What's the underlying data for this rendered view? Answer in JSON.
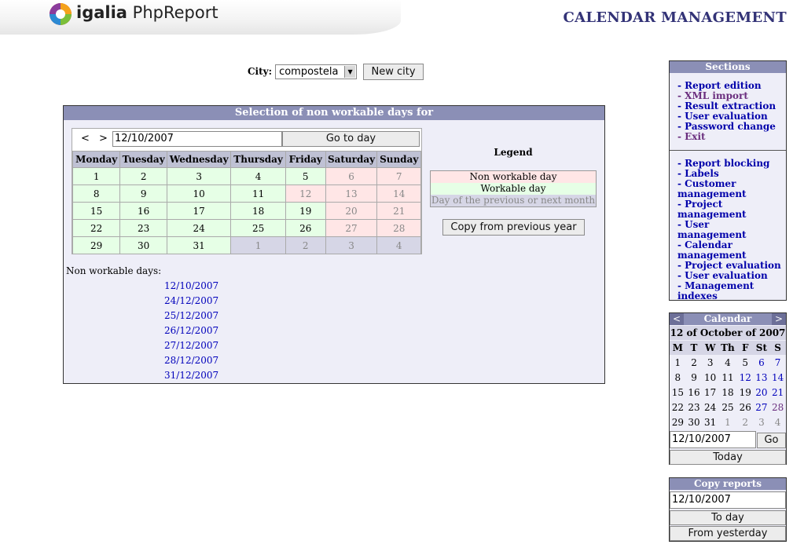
{
  "header": {
    "logo_brand": "igalia",
    "logo_product": "PhpReport",
    "page_title": "CALENDAR MANAGEMENT"
  },
  "city": {
    "label": "City:",
    "selected": "compostela",
    "new_city_label": "New city"
  },
  "panel": {
    "title": "Selection of non workable days for",
    "date_value": "12/10/2007",
    "prev_label": "<",
    "next_label": ">",
    "goto_label": "Go to day",
    "weekdays": [
      "Monday",
      "Tuesday",
      "Wednesday",
      "Thursday",
      "Friday",
      "Saturday",
      "Sunday"
    ],
    "weeks": [
      [
        {
          "d": "1",
          "t": "work"
        },
        {
          "d": "2",
          "t": "work"
        },
        {
          "d": "3",
          "t": "work"
        },
        {
          "d": "4",
          "t": "work"
        },
        {
          "d": "5",
          "t": "work"
        },
        {
          "d": "6",
          "t": "nonwork"
        },
        {
          "d": "7",
          "t": "nonwork"
        }
      ],
      [
        {
          "d": "8",
          "t": "work"
        },
        {
          "d": "9",
          "t": "work"
        },
        {
          "d": "10",
          "t": "work"
        },
        {
          "d": "11",
          "t": "work"
        },
        {
          "d": "12",
          "t": "nonwork"
        },
        {
          "d": "13",
          "t": "nonwork"
        },
        {
          "d": "14",
          "t": "nonwork"
        }
      ],
      [
        {
          "d": "15",
          "t": "work"
        },
        {
          "d": "16",
          "t": "work"
        },
        {
          "d": "17",
          "t": "work"
        },
        {
          "d": "18",
          "t": "work"
        },
        {
          "d": "19",
          "t": "work"
        },
        {
          "d": "20",
          "t": "nonwork"
        },
        {
          "d": "21",
          "t": "nonwork"
        }
      ],
      [
        {
          "d": "22",
          "t": "work"
        },
        {
          "d": "23",
          "t": "work"
        },
        {
          "d": "24",
          "t": "work"
        },
        {
          "d": "25",
          "t": "work"
        },
        {
          "d": "26",
          "t": "work"
        },
        {
          "d": "27",
          "t": "nonwork"
        },
        {
          "d": "28",
          "t": "nonwork"
        }
      ],
      [
        {
          "d": "29",
          "t": "work"
        },
        {
          "d": "30",
          "t": "work"
        },
        {
          "d": "31",
          "t": "work"
        },
        {
          "d": "1",
          "t": "other"
        },
        {
          "d": "2",
          "t": "other"
        },
        {
          "d": "3",
          "t": "other"
        },
        {
          "d": "4",
          "t": "other"
        }
      ]
    ],
    "legend_title": "Legend",
    "legend_nonwork": "Non workable day",
    "legend_work": "Workable day",
    "legend_other": "Day of the previous or next month",
    "copy_prev_label": "Copy from previous year",
    "nonwork_label": "Non workable days:",
    "nonwork_days": [
      "12/10/2007",
      "24/12/2007",
      "25/12/2007",
      "26/12/2007",
      "27/12/2007",
      "28/12/2007",
      "31/12/2007"
    ]
  },
  "sections": {
    "title": "Sections",
    "menu1": [
      {
        "label": "- Report edition",
        "visited": false
      },
      {
        "label": "- XML import",
        "visited": true
      },
      {
        "label": "- Result extraction",
        "visited": false
      },
      {
        "label": "- User evaluation",
        "visited": false
      },
      {
        "label": "- Password change",
        "visited": false
      },
      {
        "label": "- Exit",
        "visited": true
      }
    ],
    "menu2": [
      "- Report blocking",
      "- Labels",
      "- Customer management",
      "- Project management",
      "- User management",
      "- Calendar management",
      "- Project evaluation",
      "- User evaluation",
      "- Management indexes"
    ]
  },
  "mini_calendar": {
    "title": "Calendar",
    "prev": "<",
    "next": ">",
    "month_label": "12 of October of 2007",
    "weekdays": [
      "M",
      "T",
      "W",
      "Th",
      "F",
      "St",
      "S"
    ],
    "weeks": [
      [
        {
          "d": "1",
          "t": "norm"
        },
        {
          "d": "2",
          "t": "norm"
        },
        {
          "d": "3",
          "t": "norm"
        },
        {
          "d": "4",
          "t": "norm"
        },
        {
          "d": "5",
          "t": "norm"
        },
        {
          "d": "6",
          "t": "we"
        },
        {
          "d": "7",
          "t": "we"
        }
      ],
      [
        {
          "d": "8",
          "t": "norm"
        },
        {
          "d": "9",
          "t": "norm"
        },
        {
          "d": "10",
          "t": "norm"
        },
        {
          "d": "11",
          "t": "norm"
        },
        {
          "d": "12",
          "t": "we"
        },
        {
          "d": "13",
          "t": "we"
        },
        {
          "d": "14",
          "t": "we"
        }
      ],
      [
        {
          "d": "15",
          "t": "norm"
        },
        {
          "d": "16",
          "t": "norm"
        },
        {
          "d": "17",
          "t": "norm"
        },
        {
          "d": "18",
          "t": "norm"
        },
        {
          "d": "19",
          "t": "norm"
        },
        {
          "d": "20",
          "t": "we"
        },
        {
          "d": "21",
          "t": "we"
        }
      ],
      [
        {
          "d": "22",
          "t": "norm"
        },
        {
          "d": "23",
          "t": "norm"
        },
        {
          "d": "24",
          "t": "norm"
        },
        {
          "d": "25",
          "t": "norm"
        },
        {
          "d": "26",
          "t": "norm"
        },
        {
          "d": "27",
          "t": "we"
        },
        {
          "d": "28",
          "t": "sel"
        }
      ],
      [
        {
          "d": "29",
          "t": "norm"
        },
        {
          "d": "30",
          "t": "norm"
        },
        {
          "d": "31",
          "t": "norm"
        },
        {
          "d": "1",
          "t": "other"
        },
        {
          "d": "2",
          "t": "other"
        },
        {
          "d": "3",
          "t": "other"
        },
        {
          "d": "4",
          "t": "other"
        }
      ]
    ],
    "date_value": "12/10/2007",
    "go_label": "Go",
    "today_label": "Today"
  },
  "copy_reports": {
    "title": "Copy reports",
    "date_value": "12/10/2007",
    "to_day_label": "To day",
    "from_yesterday_label": "From yesterday"
  },
  "colors": {
    "header_bar": "#8b8fb6",
    "workable": "#e6ffe6",
    "non_workable": "#ffe6e6",
    "other_month": "#d6d6e6",
    "title": "#333377"
  }
}
